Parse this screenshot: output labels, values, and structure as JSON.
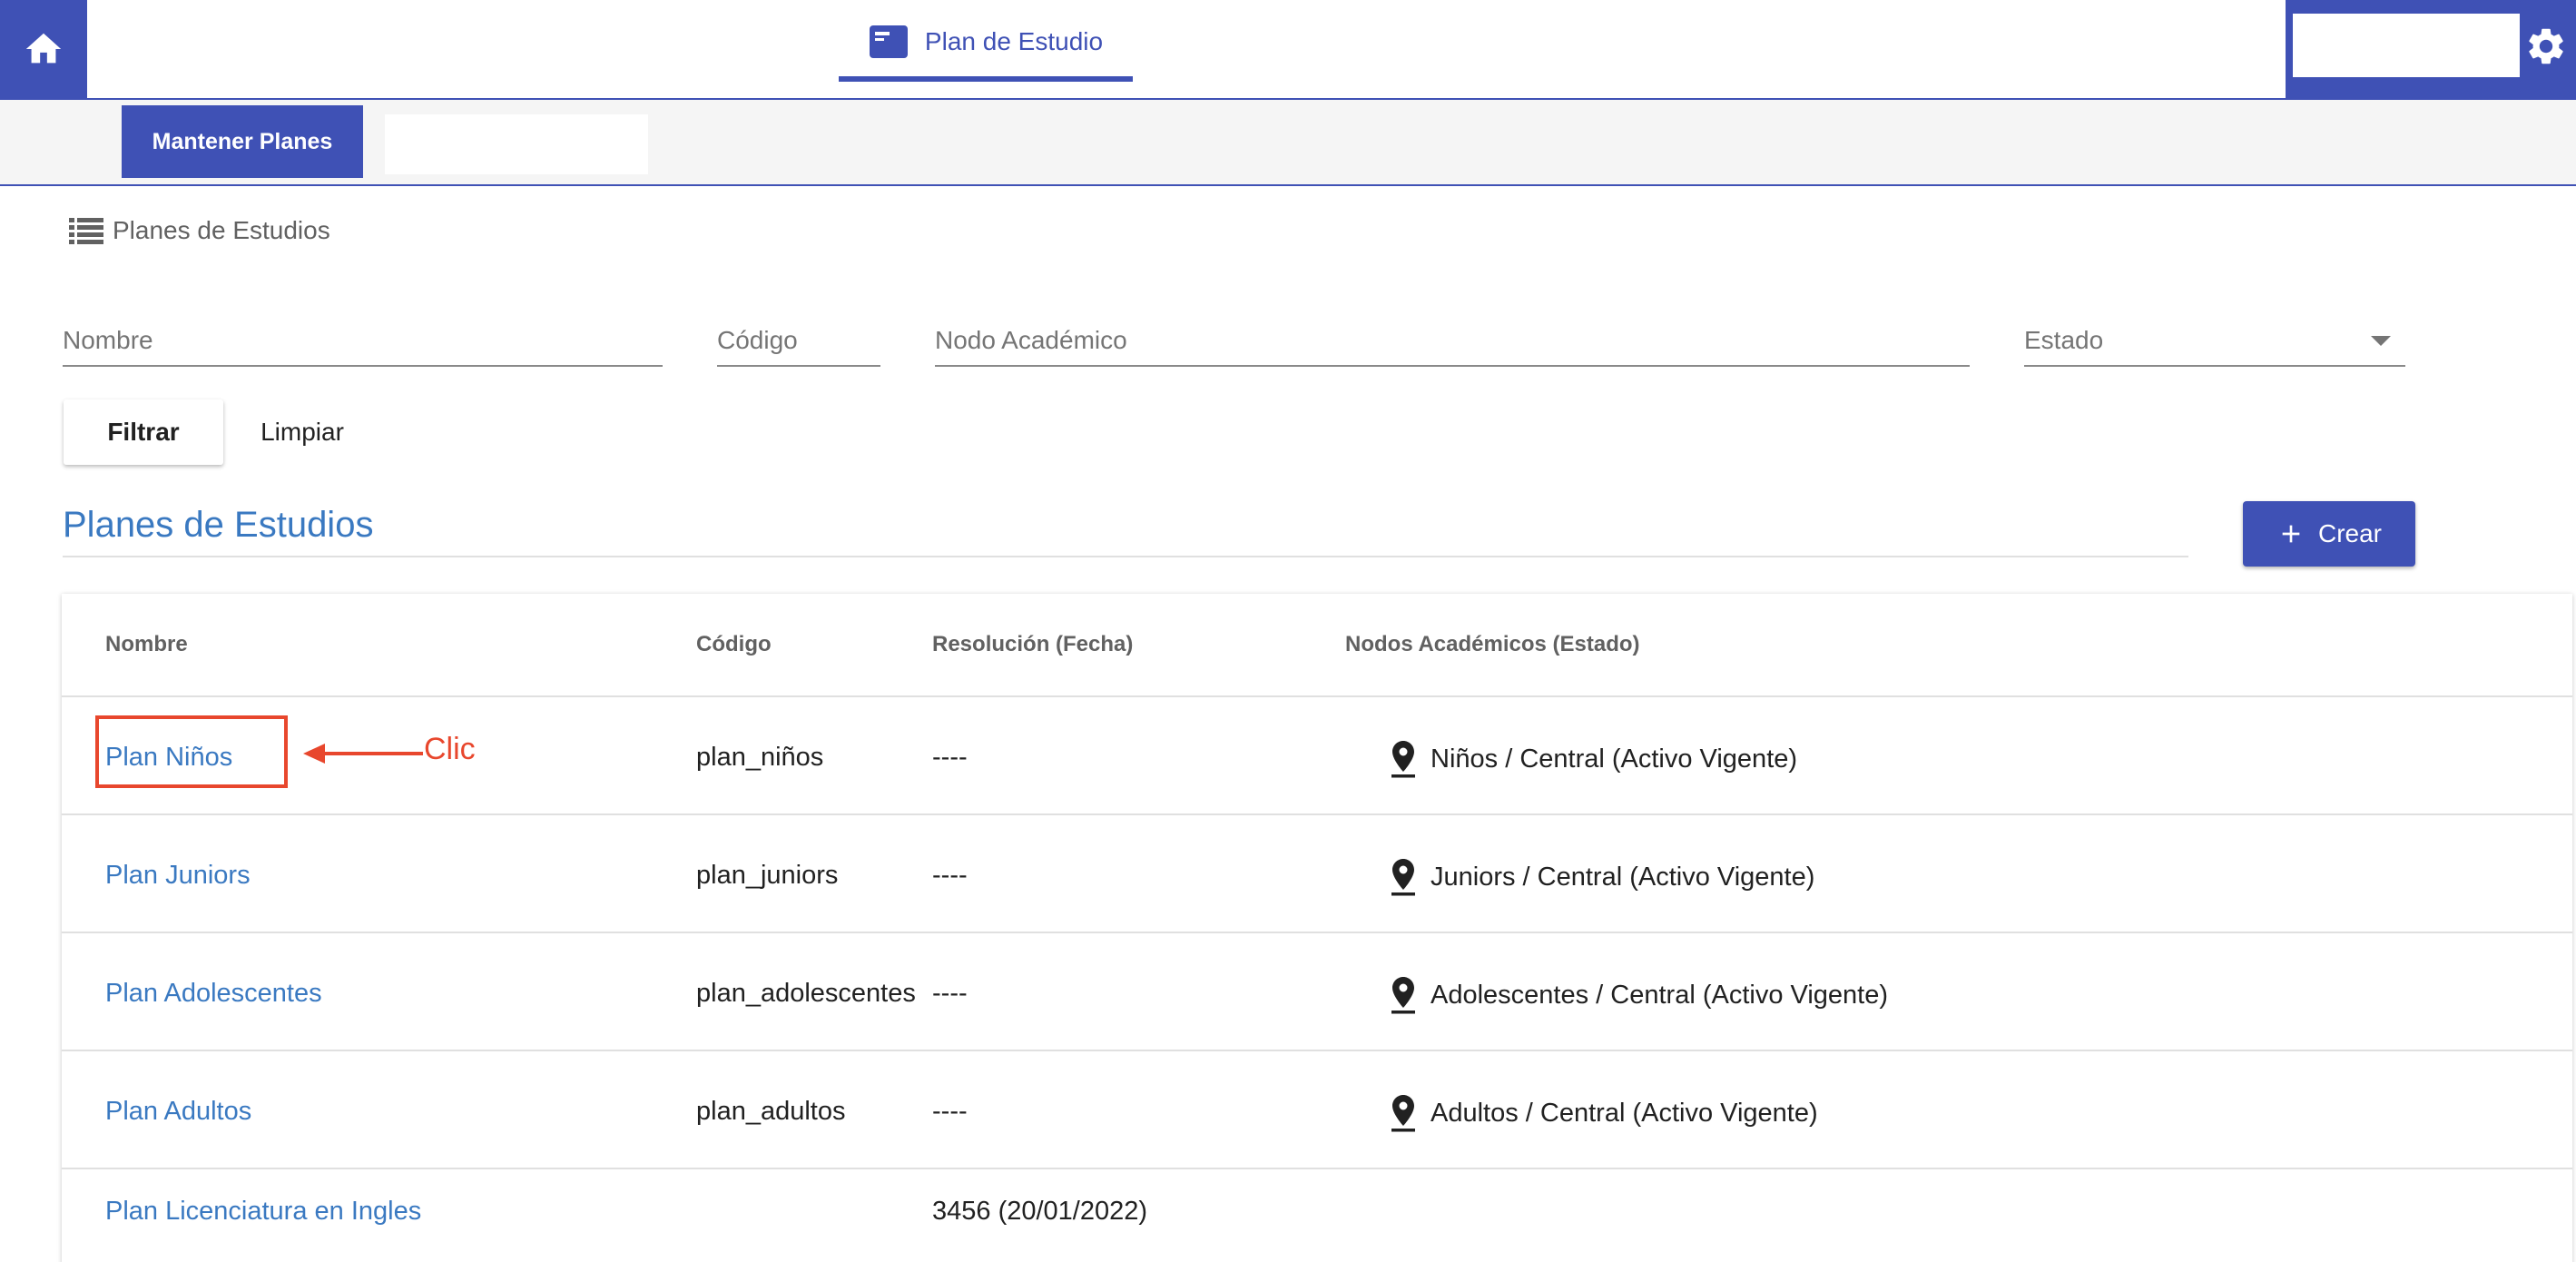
{
  "topbar": {
    "tab_label": "Plan de Estudio",
    "accent_color": "#3f51b5"
  },
  "subbar": {
    "active_label": "Mantener Planes"
  },
  "breadcrumb": {
    "label": "Planes de Estudios"
  },
  "filters": {
    "nombre_placeholder": "Nombre",
    "codigo_placeholder": "Código",
    "nodo_placeholder": "Nodo Académico",
    "estado_label": "Estado",
    "filtrar_label": "Filtrar",
    "limpiar_label": "Limpiar"
  },
  "section": {
    "title": "Planes de Estudios",
    "crear_label": "Crear"
  },
  "table": {
    "headers": [
      "Nombre",
      "Código",
      "Resolución (Fecha)",
      "Nodos Académicos (Estado)"
    ],
    "rows": [
      {
        "nombre": "Plan Niños",
        "codigo": "plan_niños",
        "resolucion": "----",
        "nodo": "Niños / Central (Activo Vigente)"
      },
      {
        "nombre": "Plan Juniors",
        "codigo": "plan_juniors",
        "resolucion": "----",
        "nodo": "Juniors / Central (Activo Vigente)"
      },
      {
        "nombre": "Plan Adolescentes",
        "codigo": "plan_adolescentes",
        "resolucion": "----",
        "nodo": "Adolescentes / Central (Activo Vigente)"
      },
      {
        "nombre": "Plan Adultos",
        "codigo": "plan_adultos",
        "resolucion": "----",
        "nodo": "Adultos / Central (Activo Vigente)"
      },
      {
        "nombre": "Plan Licenciatura en Ingles",
        "codigo": "",
        "resolucion": "3456 (20/01/2022)",
        "nodo": ""
      }
    ]
  },
  "annotation": {
    "label": "Clic",
    "color": "#e8472d"
  },
  "icons": {
    "home": "home-icon",
    "tab": "card-icon",
    "settings": "gear-icon",
    "list": "list-icon",
    "add": "plus-icon",
    "location": "location-pin-icon",
    "dropdown": "caret-down-icon"
  }
}
